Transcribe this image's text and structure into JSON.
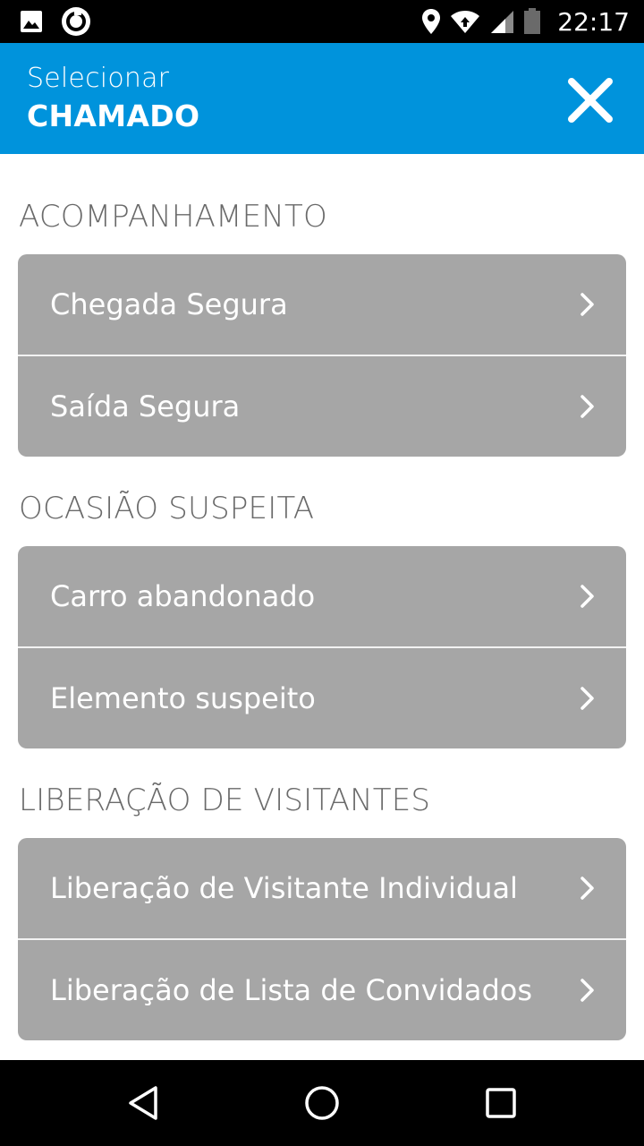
{
  "status_bar": {
    "time": "22:17",
    "left_icons": [
      "image-icon",
      "sync-circle-icon"
    ],
    "right_icons": [
      "location-pin-icon",
      "wifi-icon",
      "cell-signal-icon",
      "battery-icon"
    ]
  },
  "header": {
    "subtitle": "Selecionar",
    "title": "CHAMADO",
    "close_icon": "close-icon",
    "color": "#0093dc"
  },
  "sections": [
    {
      "title": "ACOMPANHAMENTO",
      "items": [
        {
          "label": "Chegada Segura"
        },
        {
          "label": "Saída Segura"
        }
      ]
    },
    {
      "title": "OCASIÃO SUSPEITA",
      "items": [
        {
          "label": "Carro abandonado"
        },
        {
          "label": "Elemento suspeito"
        }
      ]
    },
    {
      "title": "LIBERAÇÃO DE VISITANTES",
      "items": [
        {
          "label": "Liberação de Visitante Individual"
        },
        {
          "label": "Liberação de Lista de Convidados"
        }
      ]
    }
  ],
  "nav_bar": {
    "buttons": [
      "back-triangle-icon",
      "home-circle-icon",
      "recents-square-icon"
    ]
  },
  "colors": {
    "item_background": "#a6a6a6",
    "section_title": "#6a6a6a"
  }
}
